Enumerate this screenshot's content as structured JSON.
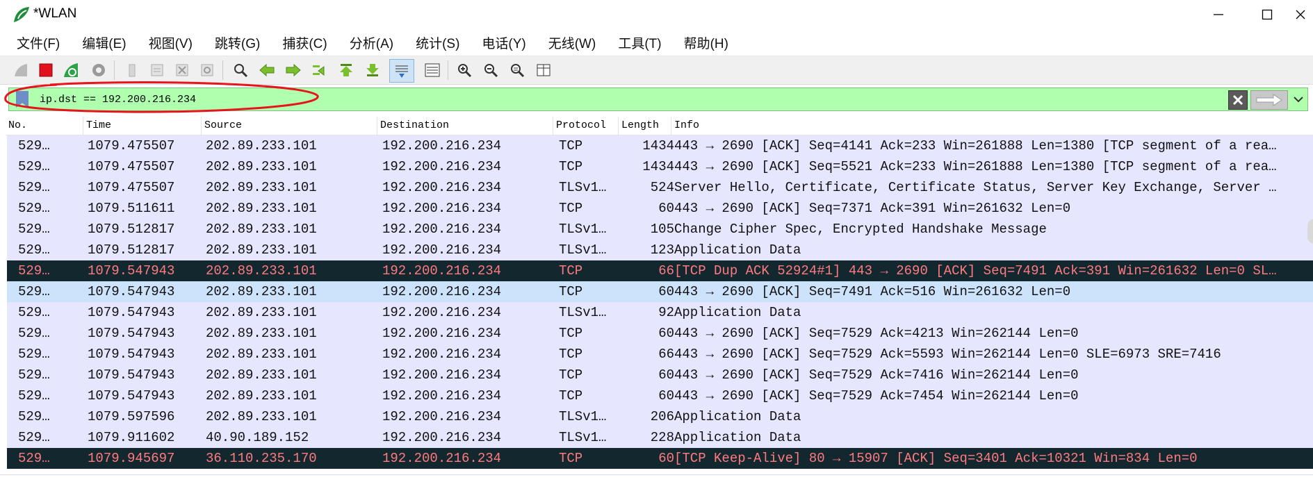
{
  "window": {
    "title": "*WLAN"
  },
  "menu": [
    "文件(F)",
    "编辑(E)",
    "视图(V)",
    "跳转(G)",
    "捕获(C)",
    "分析(A)",
    "统计(S)",
    "电话(Y)",
    "无线(W)",
    "工具(T)",
    "帮助(H)"
  ],
  "toolbar_icons": [
    "shark-fin-start-icon",
    "stop-capture-icon",
    "restart-capture-icon",
    "capture-options-icon",
    "open-file-icon",
    "save-file-icon",
    "close-file-icon",
    "reload-file-icon",
    "find-packet-icon",
    "go-back-icon",
    "go-forward-icon",
    "go-to-packet-icon",
    "first-packet-icon",
    "last-packet-icon",
    "autoscroll-icon",
    "colorize-icon",
    "zoom-in-icon",
    "zoom-out-icon",
    "normal-size-icon",
    "resize-columns-icon"
  ],
  "filter": {
    "value": "ip.dst == 192.200.216.234"
  },
  "columns": [
    "No.",
    "Time",
    "Source",
    "Destination",
    "Protocol",
    "Length",
    "Info"
  ],
  "colors": {
    "row_default": "#e7e6ff",
    "row_selected": "#cde3fb",
    "row_bad": "#12272e",
    "row_bad_text": "#ff7b80",
    "filter_bg": "#afffaf",
    "annotation": "#e8141c"
  },
  "rows": [
    {
      "no": "529…",
      "time": "1079.475507",
      "src": "202.89.233.101",
      "dst": "192.200.216.234",
      "proto": "TCP",
      "len": "1434",
      "info": "443 → 2690 [ACK] Seq=4141 Ack=233 Win=261888 Len=1380 [TCP segment of a rea…",
      "style": "normal"
    },
    {
      "no": "529…",
      "time": "1079.475507",
      "src": "202.89.233.101",
      "dst": "192.200.216.234",
      "proto": "TCP",
      "len": "1434",
      "info": "443 → 2690 [ACK] Seq=5521 Ack=233 Win=261888 Len=1380 [TCP segment of a rea…",
      "style": "normal"
    },
    {
      "no": "529…",
      "time": "1079.475507",
      "src": "202.89.233.101",
      "dst": "192.200.216.234",
      "proto": "TLSv1…",
      "len": "524",
      "info": "Server Hello, Certificate, Certificate Status, Server Key Exchange, Server …",
      "style": "normal"
    },
    {
      "no": "529…",
      "time": "1079.511611",
      "src": "202.89.233.101",
      "dst": "192.200.216.234",
      "proto": "TCP",
      "len": "60",
      "info": "443 → 2690 [ACK] Seq=7371 Ack=391 Win=261632 Len=0",
      "style": "normal"
    },
    {
      "no": "529…",
      "time": "1079.512817",
      "src": "202.89.233.101",
      "dst": "192.200.216.234",
      "proto": "TLSv1…",
      "len": "105",
      "info": "Change Cipher Spec, Encrypted Handshake Message",
      "style": "normal"
    },
    {
      "no": "529…",
      "time": "1079.512817",
      "src": "202.89.233.101",
      "dst": "192.200.216.234",
      "proto": "TLSv1…",
      "len": "123",
      "info": "Application Data",
      "style": "normal"
    },
    {
      "no": "529…",
      "time": "1079.547943",
      "src": "202.89.233.101",
      "dst": "192.200.216.234",
      "proto": "TCP",
      "len": "66",
      "info": "[TCP Dup ACK 52924#1] 443 → 2690 [ACK] Seq=7491 Ack=391 Win=261632 Len=0 SL…",
      "style": "bad"
    },
    {
      "no": "529…",
      "time": "1079.547943",
      "src": "202.89.233.101",
      "dst": "192.200.216.234",
      "proto": "TCP",
      "len": "60",
      "info": "443 → 2690 [ACK] Seq=7491 Ack=516 Win=261632 Len=0",
      "style": "selected"
    },
    {
      "no": "529…",
      "time": "1079.547943",
      "src": "202.89.233.101",
      "dst": "192.200.216.234",
      "proto": "TLSv1…",
      "len": "92",
      "info": "Application Data",
      "style": "normal"
    },
    {
      "no": "529…",
      "time": "1079.547943",
      "src": "202.89.233.101",
      "dst": "192.200.216.234",
      "proto": "TCP",
      "len": "60",
      "info": "443 → 2690 [ACK] Seq=7529 Ack=4213 Win=262144 Len=0",
      "style": "normal"
    },
    {
      "no": "529…",
      "time": "1079.547943",
      "src": "202.89.233.101",
      "dst": "192.200.216.234",
      "proto": "TCP",
      "len": "66",
      "info": "443 → 2690 [ACK] Seq=7529 Ack=5593 Win=262144 Len=0 SLE=6973 SRE=7416",
      "style": "normal"
    },
    {
      "no": "529…",
      "time": "1079.547943",
      "src": "202.89.233.101",
      "dst": "192.200.216.234",
      "proto": "TCP",
      "len": "60",
      "info": "443 → 2690 [ACK] Seq=7529 Ack=7416 Win=262144 Len=0",
      "style": "normal"
    },
    {
      "no": "529…",
      "time": "1079.547943",
      "src": "202.89.233.101",
      "dst": "192.200.216.234",
      "proto": "TCP",
      "len": "60",
      "info": "443 → 2690 [ACK] Seq=7529 Ack=7454 Win=262144 Len=0",
      "style": "normal"
    },
    {
      "no": "529…",
      "time": "1079.597596",
      "src": "202.89.233.101",
      "dst": "192.200.216.234",
      "proto": "TLSv1…",
      "len": "206",
      "info": "Application Data",
      "style": "normal"
    },
    {
      "no": "529…",
      "time": "1079.911602",
      "src": "40.90.189.152",
      "dst": "192.200.216.234",
      "proto": "TLSv1…",
      "len": "228",
      "info": "Application Data",
      "style": "normal"
    },
    {
      "no": "529…",
      "time": "1079.945697",
      "src": "36.110.235.170",
      "dst": "192.200.216.234",
      "proto": "TCP",
      "len": "60",
      "info": "[TCP Keep-Alive] 80 → 15907 [ACK] Seq=3401 Ack=10321 Win=834 Len=0",
      "style": "bad"
    }
  ]
}
